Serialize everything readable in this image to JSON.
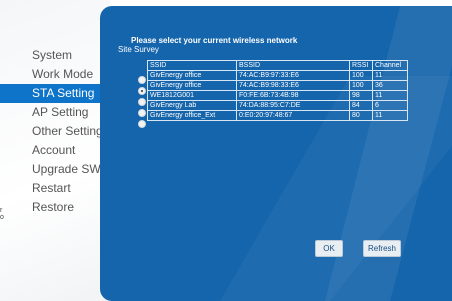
{
  "brand_fragment": [
    "r",
    "o"
  ],
  "menu": [
    {
      "label": "System",
      "active": false
    },
    {
      "label": "Work Mode",
      "active": false
    },
    {
      "label": "STA Setting",
      "active": true
    },
    {
      "label": "AP Setting",
      "active": false
    },
    {
      "label": "Other Setting",
      "active": false
    },
    {
      "label": "Account",
      "active": false
    },
    {
      "label": "Upgrade SW",
      "active": false
    },
    {
      "label": "Restart",
      "active": false
    },
    {
      "label": "Restore",
      "active": false
    }
  ],
  "panel": {
    "title": "Please select your current wireless network",
    "subtitle": "Site Survey",
    "columns": [
      "SSID",
      "BSSID",
      "RSSI",
      "Channel"
    ],
    "rows": [
      {
        "selected": false,
        "ssid": "GivEnergy office",
        "bssid": "74:AC:B9:97:33:E6",
        "rssi": "100",
        "channel": "11"
      },
      {
        "selected": true,
        "ssid": "GivEnergy office",
        "bssid": "74:AC:B9:98:33:E6",
        "rssi": "100",
        "channel": "36"
      },
      {
        "selected": false,
        "ssid": "WE1812G001",
        "bssid": "F0:FE:6B:73:4B:98",
        "rssi": "98",
        "channel": "11"
      },
      {
        "selected": false,
        "ssid": "GivEnergy Lab",
        "bssid": "74:DA:88:95:C7:DE",
        "rssi": "84",
        "channel": "6"
      },
      {
        "selected": false,
        "ssid": "GivEnergy office_Ext",
        "bssid": "0:E0:20:97:48:67",
        "rssi": "80",
        "channel": "11"
      }
    ],
    "ok_label": "OK",
    "refresh_label": "Refresh"
  },
  "colors": {
    "accent": "#0d74c9",
    "panel": "#1565ac",
    "menu_text": "#555555"
  }
}
